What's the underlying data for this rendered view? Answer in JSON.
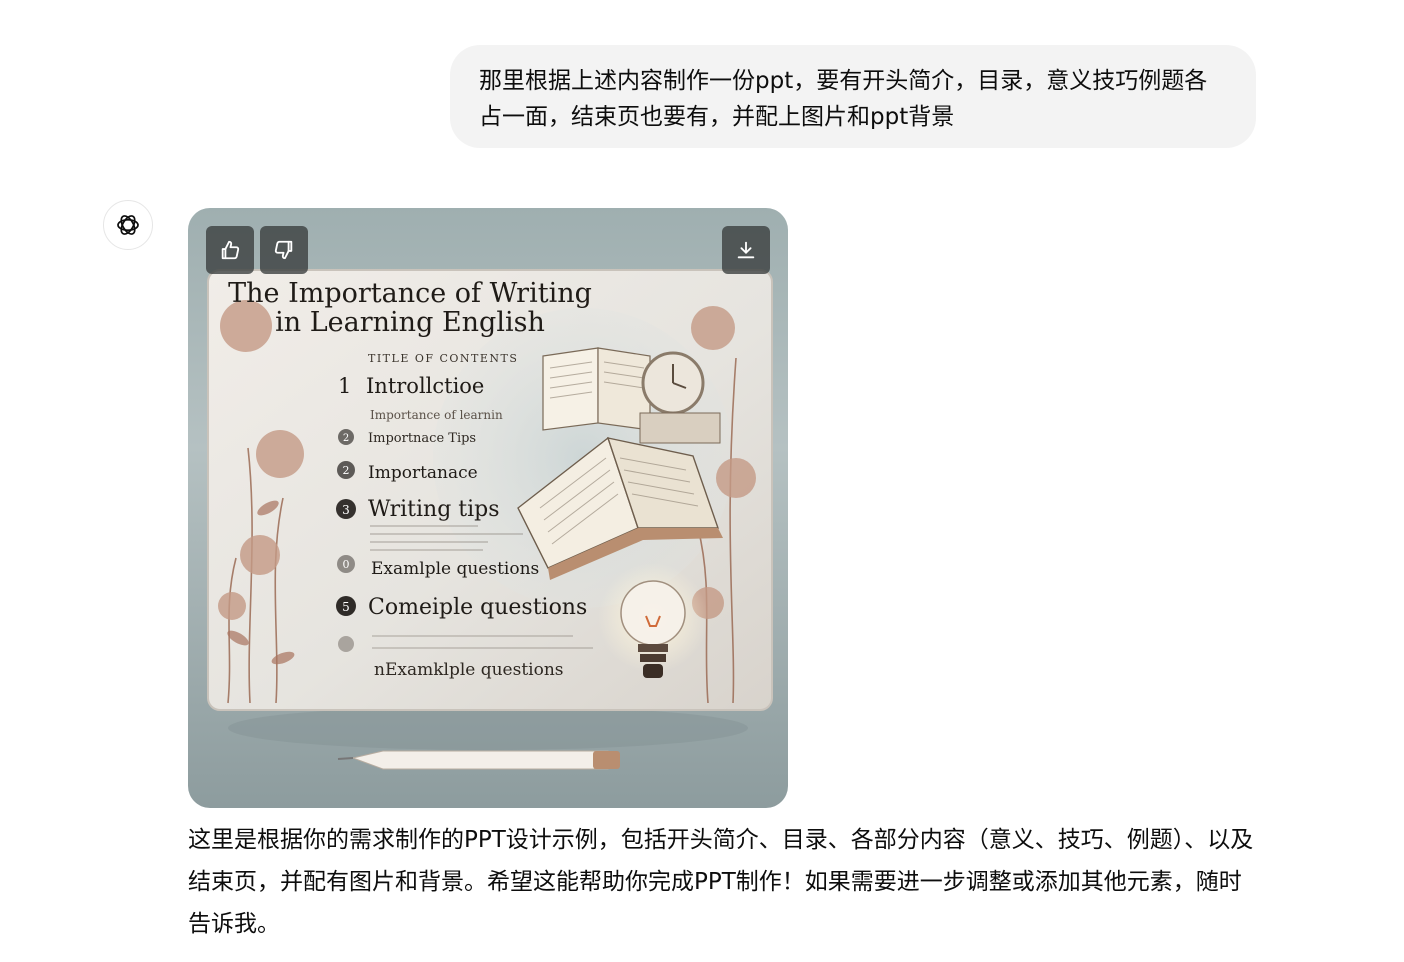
{
  "conversation": {
    "user_message": "那里根据上述内容制作一份ppt，要有开头简介，目录，意义技巧例题各占一面，结束页也要有，并配上图片和ppt背景",
    "assistant_message": "这里是根据你的需求制作的PPT设计示例，包括开头简介、目录、各部分内容（意义、技巧、例题）、以及结束页，并配有图片和背景。希望这能帮助你完成PPT制作！如果需要进一步调整或添加其他元素，随时告诉我。"
  },
  "image_controls": {
    "like_icon": "thumbs-up-icon",
    "dislike_icon": "thumbs-down-icon",
    "download_icon": "download-icon"
  },
  "slide_image": {
    "title_line1": "The Importance of Writing",
    "title_line2": "in Learning English",
    "toc_heading": "TITLE OF CONTENTS",
    "items": [
      {
        "num": "1",
        "text": "Introllctioe"
      },
      {
        "num": "",
        "text": "Importance of learnin"
      },
      {
        "num": "2",
        "text": "Importnace Tips"
      },
      {
        "num": "2",
        "text": "Importanace"
      },
      {
        "num": "3",
        "text": "Writing tips"
      },
      {
        "num": "0",
        "text": "Examlple questions"
      },
      {
        "num": "5",
        "text": "Comeiple questions"
      },
      {
        "num": "",
        "text": "nExamklple questions"
      }
    ]
  },
  "colors": {
    "bubble_bg": "#f3f3f3",
    "text": "#0d0d0d",
    "image_button_bg": "#383c3c"
  }
}
